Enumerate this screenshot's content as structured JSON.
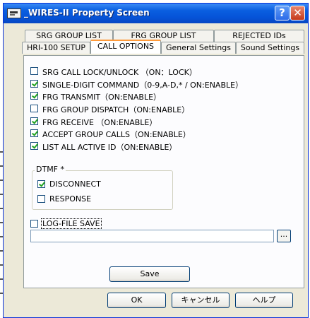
{
  "window": {
    "title": "_WIRES-II Property Screen"
  },
  "titlebar": {
    "help_glyph": "?",
    "close_glyph": "✕"
  },
  "tabs": {
    "back_row": [
      {
        "label": "SRG GROUP LIST"
      },
      {
        "label": "FRG GROUP LIST"
      },
      {
        "label": "REJECTED IDs"
      }
    ],
    "front_row": [
      {
        "label": "HRI-100 SETUP",
        "active": false
      },
      {
        "label": "CALL OPTIONS",
        "active": true
      },
      {
        "label": "General Settings",
        "active": false
      },
      {
        "label": "Sound Settings",
        "active": false
      }
    ]
  },
  "options": [
    {
      "label": "SRG CALL LOCK/UNLOCK （ON：LOCK）",
      "checked": false
    },
    {
      "label": "SINGLE-DIGIT COMMAND（0-9,A-D,* / ON:ENABLE）",
      "checked": true
    },
    {
      "label": "FRG TRANSMIT（ON:ENABLE）",
      "checked": true
    },
    {
      "label": "FRG GROUP DISPATCH（ON:ENABLE）",
      "checked": false
    },
    {
      "label": "FRG RECEIVE （ON:ENABLE）",
      "checked": true
    },
    {
      "label": "ACCEPT GROUP CALLS（ON:ENABLE）",
      "checked": true
    },
    {
      "label": "LIST ALL ACTIVE ID（ON:ENABLE）",
      "checked": true
    }
  ],
  "dtmf": {
    "label": "DTMF *",
    "options": [
      {
        "label": "DISCONNECT",
        "checked": true
      },
      {
        "label": "RESPONSE",
        "checked": false
      }
    ]
  },
  "log": {
    "label": "LOG-FILE SAVE",
    "checked": false,
    "path_value": "",
    "browse_label": "..."
  },
  "buttons": {
    "save": "Save",
    "ok": "OK",
    "cancel": "キャンセル",
    "help": "ヘルプ"
  }
}
